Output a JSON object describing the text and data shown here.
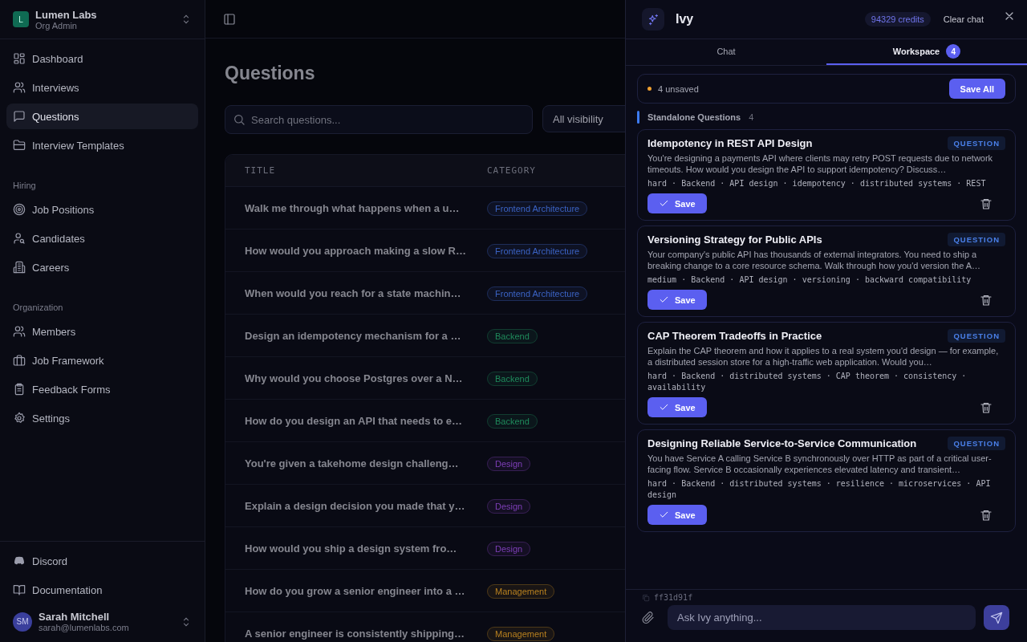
{
  "sidebar": {
    "org": {
      "initial": "L",
      "name": "Lumen Labs",
      "role": "Org Admin"
    },
    "sections": [
      {
        "items": [
          {
            "label": "Dashboard",
            "selected": false
          },
          {
            "label": "Interviews",
            "selected": false
          },
          {
            "label": "Questions",
            "selected": true
          },
          {
            "label": "Interview Templates",
            "selected": false
          }
        ]
      },
      {
        "heading": "Hiring",
        "items": [
          {
            "label": "Job Positions",
            "selected": false
          },
          {
            "label": "Candidates",
            "selected": false
          },
          {
            "label": "Careers",
            "selected": false
          }
        ]
      },
      {
        "heading": "Organization",
        "items": [
          {
            "label": "Members",
            "selected": false
          },
          {
            "label": "Job Framework",
            "selected": false
          },
          {
            "label": "Feedback Forms",
            "selected": false
          },
          {
            "label": "Settings",
            "selected": false
          }
        ]
      }
    ],
    "footer_links": [
      {
        "label": "Discord"
      },
      {
        "label": "Documentation"
      }
    ],
    "user": {
      "initials": "SM",
      "name": "Sarah Mitchell",
      "email": "sarah@lumenlabs.com"
    }
  },
  "page": {
    "title": "Questions",
    "search": {
      "placeholder": "Search questions..."
    },
    "visibility_filter": "All visibility",
    "table": {
      "columns": [
        "TITLE",
        "CATEGORY"
      ],
      "rows": [
        {
          "title": "Walk me through what happens when a u…",
          "category": "Frontend Architecture",
          "color": "#3b63c4"
        },
        {
          "title": "How would you approach making a slow R…",
          "category": "Frontend Architecture",
          "color": "#3b63c4"
        },
        {
          "title": "When would you reach for a state machin…",
          "category": "Frontend Architecture",
          "color": "#3b63c4"
        },
        {
          "title": "Design an idempotency mechanism for a …",
          "category": "Backend",
          "color": "#1f8a5b"
        },
        {
          "title": "Why would you choose Postgres over a N…",
          "category": "Backend",
          "color": "#1f8a5b"
        },
        {
          "title": "How do you design an API that needs to e…",
          "category": "Backend",
          "color": "#1f8a5b"
        },
        {
          "title": "You're given a takehome design challeng…",
          "category": "Design",
          "color": "#7e3fb8"
        },
        {
          "title": "Explain a design decision you made that y…",
          "category": "Design",
          "color": "#7e3fb8"
        },
        {
          "title": "How would you ship a design system fro…",
          "category": "Design",
          "color": "#7e3fb8"
        },
        {
          "title": "How do you grow a senior engineer into a …",
          "category": "Management",
          "color": "#b8801f"
        },
        {
          "title": "A senior engineer is consistently shipping…",
          "category": "Management",
          "color": "#b8801f"
        }
      ]
    }
  },
  "assistant": {
    "name": "Ivy",
    "credits": "94329 credits",
    "clear_label": "Clear chat",
    "tabs": [
      {
        "label": "Chat",
        "selected": false
      },
      {
        "label": "Workspace",
        "selected": true,
        "badge": "4"
      }
    ],
    "unsaved": "4 unsaved",
    "save_all": "Save All",
    "section": {
      "title": "Standalone Questions",
      "count": "4"
    },
    "cards": [
      {
        "title": "Idempotency in REST API Design",
        "badge": "QUESTION",
        "description": "You're designing a payments API where clients may retry POST requests due to network timeouts. How would you design the API to support idempotency? Discuss…",
        "meta": "hard · Backend · API design · idempotency · distributed systems · REST",
        "action": "Save"
      },
      {
        "title": "Versioning Strategy for Public APIs",
        "badge": "QUESTION",
        "description": "Your company's public API has thousands of external integrators. You need to ship a breaking change to a core resource schema. Walk through how you'd version the A…",
        "meta": "medium · Backend · API design · versioning · backward compatibility",
        "action": "Save"
      },
      {
        "title": "CAP Theorem Tradeoffs in Practice",
        "badge": "QUESTION",
        "description": "Explain the CAP theorem and how it applies to a real system you'd design — for example, a distributed session store for a high-traffic web application. Would you…",
        "meta": "hard · Backend · distributed systems · CAP theorem · consistency · availability",
        "action": "Save"
      },
      {
        "title": "Designing Reliable Service-to-Service Communication",
        "badge": "QUESTION",
        "description": "You have Service A calling Service B synchronously over HTTP as part of a critical user-facing flow. Service B occasionally experiences elevated latency and transient…",
        "meta": "hard · Backend · distributed systems · resilience · microservices · API design",
        "action": "Save"
      }
    ],
    "version": "ff31d91f",
    "composer": {
      "placeholder": "Ask Ivy anything..."
    }
  }
}
